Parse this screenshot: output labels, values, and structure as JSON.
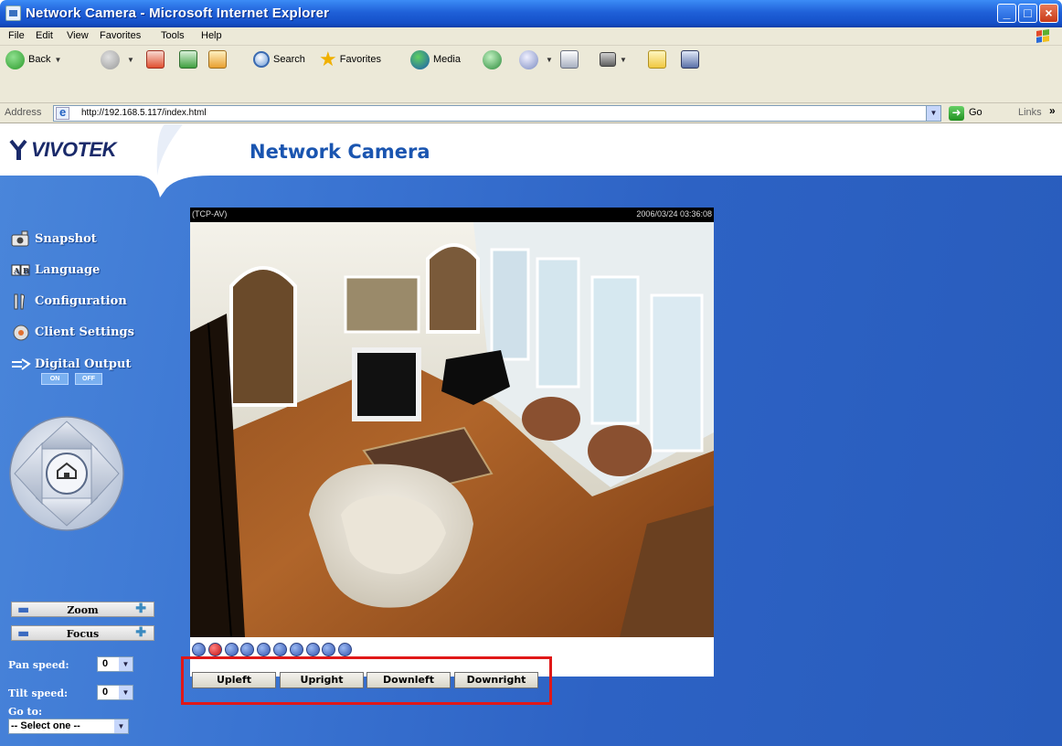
{
  "window": {
    "title": "Network Camera - Microsoft Internet Explorer"
  },
  "menubar": {
    "items": [
      "File",
      "Edit",
      "View",
      "Favorites",
      "Tools",
      "Help"
    ]
  },
  "toolbar": {
    "back": "Back",
    "search": "Search",
    "favorites": "Favorites",
    "media": "Media"
  },
  "address": {
    "label": "Address",
    "url": "http://192.168.5.117/index.html",
    "go": "Go",
    "links": "Links",
    "links_chevron": "»"
  },
  "page": {
    "logo": "VIVOTEK",
    "title": "Network Camera"
  },
  "sidebar": {
    "snapshot": "Snapshot",
    "language": "Language",
    "configuration": "Configuration",
    "client_settings": "Client Settings",
    "digital_output": "Digital Output",
    "do_on": "ON",
    "do_off": "OFF",
    "zoom": "Zoom",
    "focus": "Focus",
    "pan_speed_label": "Pan speed:",
    "pan_speed_value": "0",
    "tilt_speed_label": "Tilt speed:",
    "tilt_speed_value": "0",
    "goto_label": "Go to:",
    "goto_value": "-- Select one --"
  },
  "video": {
    "protocol": "(TCP-AV)",
    "timestamp": "2006/03/24 03:36:08"
  },
  "ptz_buttons": [
    "Upleft",
    "Upright",
    "Downleft",
    "Downright"
  ],
  "colors": {
    "titlebar": "#1f60d8",
    "page_bg": "#2d62c4",
    "highlight": "#e01818",
    "title_text": "#1a55b0"
  }
}
